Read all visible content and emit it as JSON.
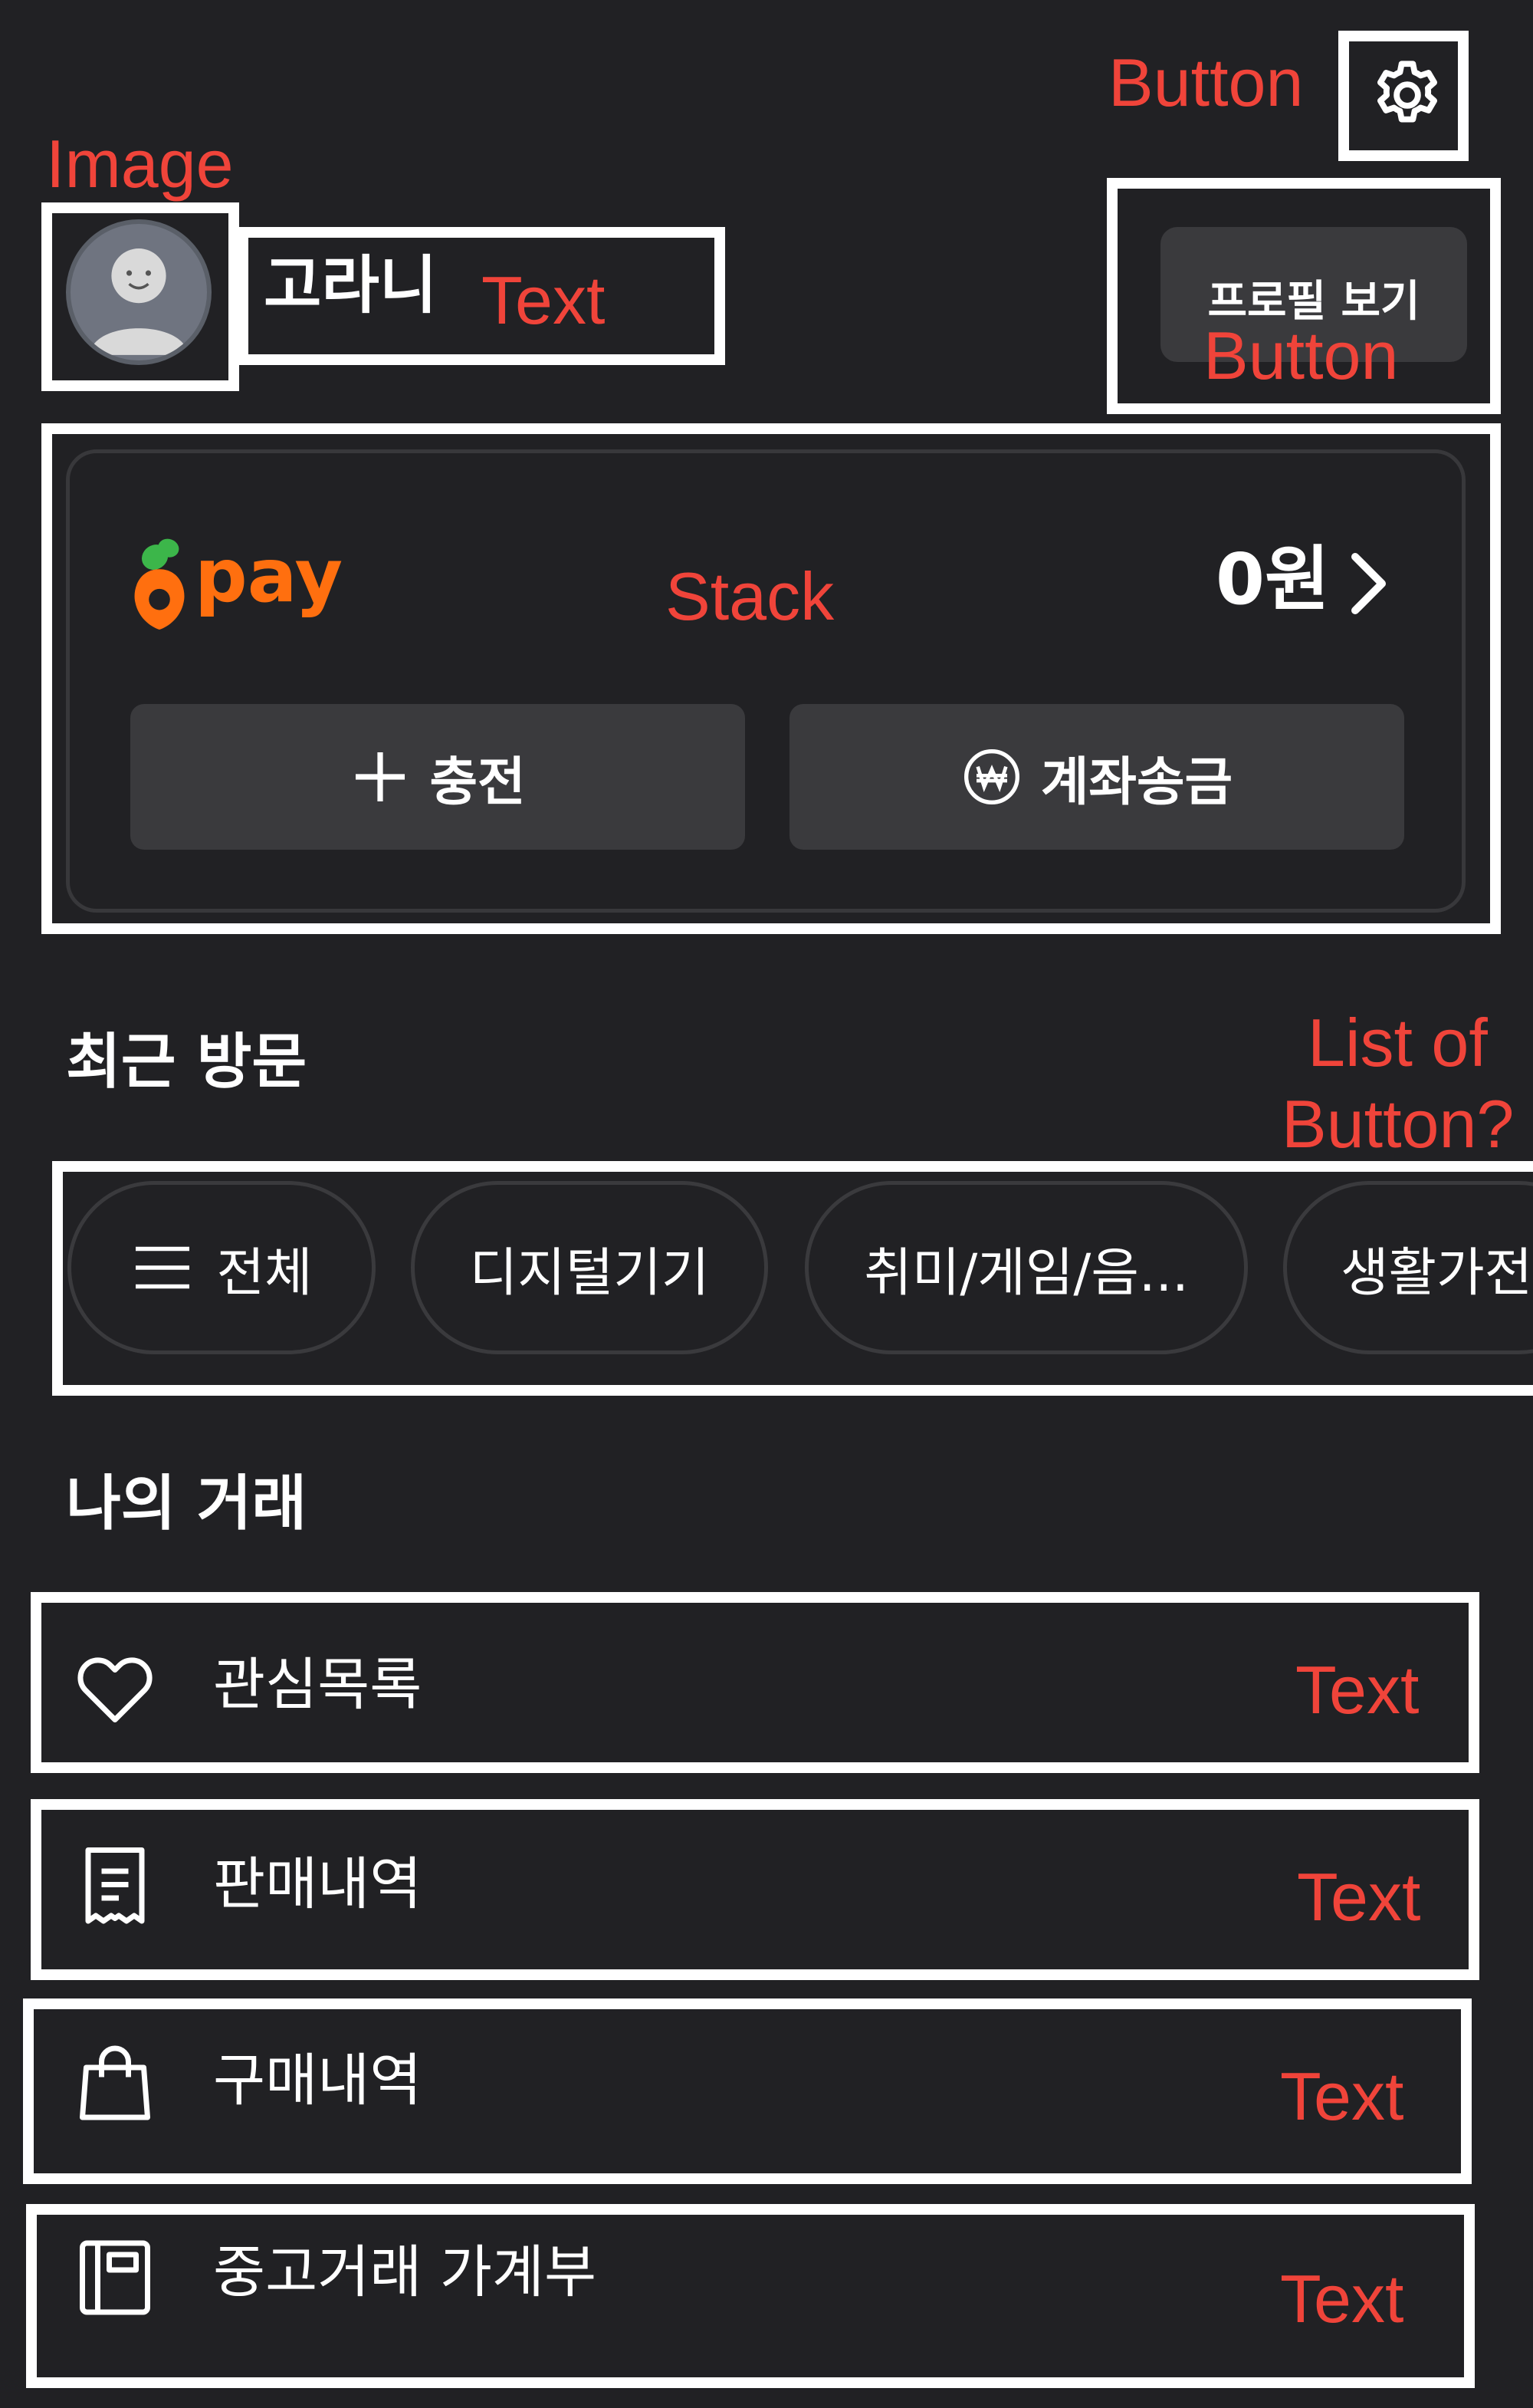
{
  "annotations": {
    "settings_button": "Button",
    "avatar_image": "Image",
    "nickname_text": "Text",
    "profile_button": "Button",
    "pay_stack": "Stack",
    "chips_list_line1": "List of",
    "chips_list_line2": "Button?",
    "row_text": "Text"
  },
  "header": {
    "settings_icon": "gear-icon"
  },
  "profile": {
    "nickname": "고라니",
    "view_profile_label": "프로필 보기"
  },
  "pay": {
    "logo_text": "pay",
    "balance": "0원",
    "charge_label": "충전",
    "transfer_label": "계좌송금",
    "brand_color": "#ff6f0f"
  },
  "recent": {
    "title": "최근 방문",
    "chips": [
      {
        "label": "전체",
        "icon": "menu-icon"
      },
      {
        "label": "디지털기기"
      },
      {
        "label": "취미/게임/음..."
      },
      {
        "label": "생활가전"
      }
    ]
  },
  "my_trades": {
    "title": "나의 거래",
    "items": [
      {
        "label": "관심목록",
        "icon": "heart-icon"
      },
      {
        "label": "판매내역",
        "icon": "receipt-icon"
      },
      {
        "label": "구매내역",
        "icon": "shopping-bag-icon"
      },
      {
        "label": "중고거래 가계부",
        "icon": "ledger-icon"
      }
    ]
  }
}
